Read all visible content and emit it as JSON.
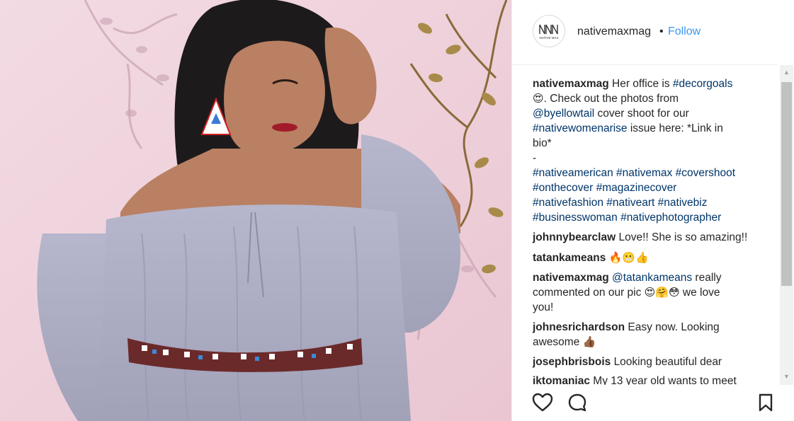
{
  "post": {
    "username": "nativemaxmag",
    "separator": "•",
    "follow_label": "Follow",
    "avatar_text": "NATIVE MAX"
  },
  "caption": {
    "user": "nativemaxmag",
    "l1": "Her office is ",
    "l1_tag": "#decorgoals",
    "l2_emoji": "😍",
    "l2": ". Check out the photos from",
    "l3_tag": "@byellowtail",
    "l3": " cover shoot for our",
    "l4_tag": "#nativewomenarise",
    "l4": " issue here: *Link in",
    "l5": "bio*",
    "l6": "-",
    "l7": "#nativeamerican #nativemax #covershoot",
    "l8": "#onthecover #magazinecover",
    "l9": "#nativefashion #nativeart #nativebiz",
    "l10": "#businesswoman #nativephotographer"
  },
  "comments": [
    {
      "user": "johnnybearclaw",
      "text": "Love!! She is so amazing!!"
    },
    {
      "user": "tatankameans",
      "text": "🔥😬👍"
    },
    {
      "user": "nativemaxmag",
      "tag": "@tatankameans",
      "text_a": " really",
      "text_b": "commented on our pic ",
      "emoji": "😍🤗😳",
      "text_c": " we love",
      "text_d": "you!"
    },
    {
      "user": "johnesrichardson",
      "text_a": "Easy now. Looking",
      "text_b": "awesome ",
      "emoji": "👍🏾"
    },
    {
      "user": "josephbrisbois",
      "text": "Looking beautiful dear"
    },
    {
      "user": "iktomaniac",
      "text": "My 13 year old wants to meet"
    }
  ],
  "icons": {
    "like": "heart-icon",
    "comment": "comment-icon",
    "save": "bookmark-icon",
    "scroll_up": "▲",
    "scroll_down": "▼"
  },
  "colors": {
    "link": "#003569",
    "follow": "#3897f0",
    "wall": "#f0d3dc"
  }
}
